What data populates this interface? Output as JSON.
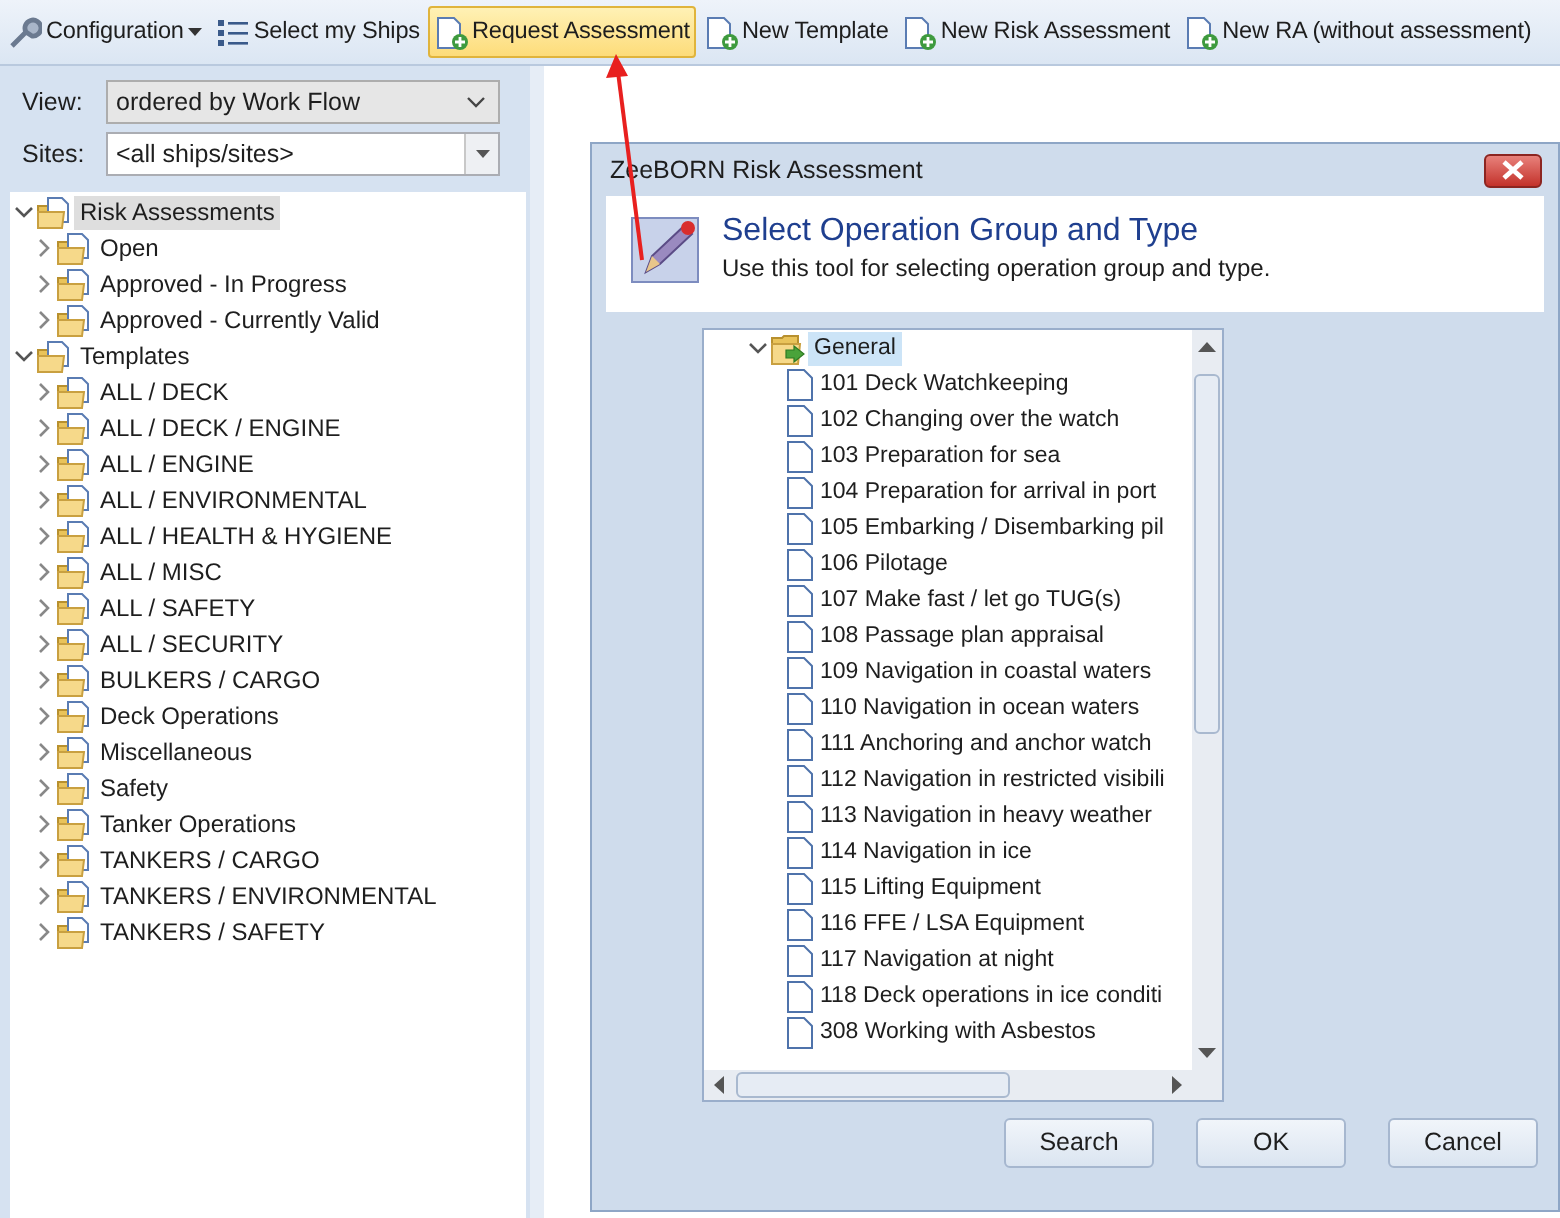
{
  "toolbar": [
    {
      "label": "Configuration",
      "kind": "menu",
      "selected": false
    },
    {
      "label": "Select my Ships",
      "kind": "list",
      "selected": false
    },
    {
      "label": "Request Assessment",
      "kind": "new-doc",
      "selected": true
    },
    {
      "label": "New Template",
      "kind": "new-doc",
      "selected": false
    },
    {
      "label": "New Risk Assessment",
      "kind": "new-doc",
      "selected": false
    },
    {
      "label": "New RA (without assessment)",
      "kind": "new-doc",
      "selected": false
    }
  ],
  "filters": [
    {
      "label": "View:",
      "value": "ordered by Work Flow",
      "kind": "select"
    },
    {
      "label": "Sites:",
      "value": "<all ships/sites>",
      "kind": "combo"
    }
  ],
  "tree": [
    {
      "label": "Risk Assessments",
      "kind": "folder",
      "expanded": true,
      "selected": true,
      "children": [
        {
          "label": "Open",
          "kind": "folder",
          "expanded": false,
          "selected": false
        },
        {
          "label": "Approved - In Progress",
          "kind": "folder",
          "expanded": false,
          "selected": false
        },
        {
          "label": "Approved - Currently Valid",
          "kind": "folder",
          "expanded": false,
          "selected": false
        }
      ]
    },
    {
      "label": "Templates",
      "kind": "folder",
      "expanded": true,
      "selected": false,
      "children": [
        {
          "label": "ALL / DECK",
          "kind": "folder",
          "expanded": false,
          "selected": false
        },
        {
          "label": "ALL / DECK / ENGINE",
          "kind": "folder",
          "expanded": false,
          "selected": false
        },
        {
          "label": "ALL / ENGINE",
          "kind": "folder",
          "expanded": false,
          "selected": false
        },
        {
          "label": "ALL / ENVIRONMENTAL",
          "kind": "folder",
          "expanded": false,
          "selected": false
        },
        {
          "label": "ALL / HEALTH & HYGIENE",
          "kind": "folder",
          "expanded": false,
          "selected": false
        },
        {
          "label": "ALL / MISC",
          "kind": "folder",
          "expanded": false,
          "selected": false
        },
        {
          "label": "ALL / SAFETY",
          "kind": "folder",
          "expanded": false,
          "selected": false
        },
        {
          "label": "ALL / SECURITY",
          "kind": "folder",
          "expanded": false,
          "selected": false
        },
        {
          "label": "BULKERS / CARGO",
          "kind": "folder",
          "expanded": false,
          "selected": false
        },
        {
          "label": "Deck Operations",
          "kind": "folder",
          "expanded": false,
          "selected": false
        },
        {
          "label": "Miscellaneous",
          "kind": "folder",
          "expanded": false,
          "selected": false
        },
        {
          "label": "Safety",
          "kind": "folder",
          "expanded": false,
          "selected": false
        },
        {
          "label": "Tanker Operations",
          "kind": "folder",
          "expanded": false,
          "selected": false
        },
        {
          "label": "TANKERS / CARGO",
          "kind": "folder",
          "expanded": false,
          "selected": false
        },
        {
          "label": "TANKERS / ENVIRONMENTAL",
          "kind": "folder",
          "expanded": false,
          "selected": false
        },
        {
          "label": "TANKERS / SAFETY",
          "kind": "folder",
          "expanded": false,
          "selected": false
        }
      ]
    }
  ],
  "dialog": {
    "title": "ZeeBORN Risk Assessment",
    "header": {
      "title": "Select Operation Group and Type",
      "subtitle": "Use this tool for selecting operation group and type."
    },
    "tree": [
      {
        "label": "General",
        "kind": "group",
        "expanded": true,
        "selected": true,
        "children": [
          {
            "label": "101 Deck Watchkeeping",
            "kind": "document",
            "selected": false
          },
          {
            "label": "102 Changing over the watch",
            "kind": "document",
            "selected": false
          },
          {
            "label": "103 Preparation for sea",
            "kind": "document",
            "selected": false
          },
          {
            "label": "104 Preparation for arrival in port",
            "kind": "document",
            "selected": false
          },
          {
            "label": "105 Embarking / Disembarking pil",
            "kind": "document",
            "selected": false
          },
          {
            "label": "106 Pilotage",
            "kind": "document",
            "selected": false
          },
          {
            "label": "107 Make fast / let go TUG(s)",
            "kind": "document",
            "selected": false
          },
          {
            "label": "108 Passage plan appraisal",
            "kind": "document",
            "selected": false
          },
          {
            "label": "109 Navigation in coastal waters",
            "kind": "document",
            "selected": false
          },
          {
            "label": "110 Navigation in ocean waters",
            "kind": "document",
            "selected": false
          },
          {
            "label": "111 Anchoring and anchor watch",
            "kind": "document",
            "selected": false
          },
          {
            "label": "112 Navigation in restricted visibili",
            "kind": "document",
            "selected": false
          },
          {
            "label": "113 Navigation in heavy weather",
            "kind": "document",
            "selected": false
          },
          {
            "label": "114 Navigation in ice",
            "kind": "document",
            "selected": false
          },
          {
            "label": "115 Lifting Equipment",
            "kind": "document",
            "selected": false
          },
          {
            "label": "116 FFE / LSA Equipment",
            "kind": "document",
            "selected": false
          },
          {
            "label": "117 Navigation at night",
            "kind": "document",
            "selected": false
          },
          {
            "label": "118 Deck operations in ice conditi",
            "kind": "document",
            "selected": false
          },
          {
            "label": "308 Working with Asbestos",
            "kind": "document",
            "selected": false
          }
        ]
      }
    ],
    "buttons": [
      "Search",
      "OK",
      "Cancel"
    ]
  }
}
